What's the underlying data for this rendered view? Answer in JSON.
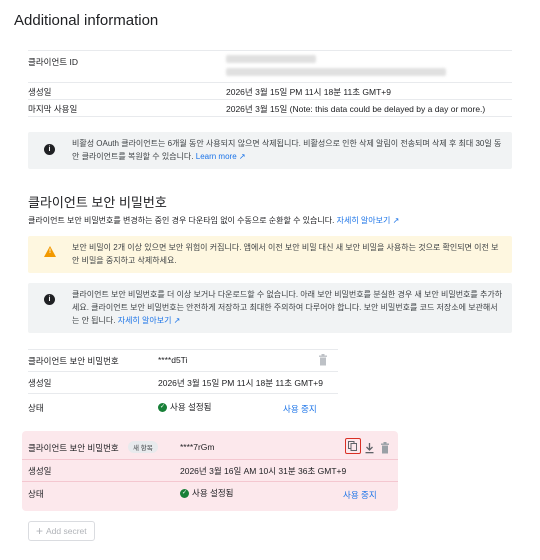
{
  "page_title": "Additional information",
  "client_info": {
    "client_id_label": "클라이언트 ID",
    "created_label": "생성일",
    "created_value": "2026년 3월 15일 PM 11시 18분 11초 GMT+9",
    "last_used_label": "마지막 사용일",
    "last_used_value": "2026년 3월 15일 (Note: this data could be delayed by a day or more.)"
  },
  "inactive_notice": {
    "text": "비활성 OAuth 클라이언트는 6개월 동안 사용되지 않으면 삭제됩니다. 비활성으로 인한 삭제 알림이 전송되며 삭제 후 최대 30일 동안 클라이언트를 복원할 수 있습니다.",
    "link": "Learn more"
  },
  "secrets_section": {
    "title": "클라이언트 보안 비밀번호",
    "description": "클라이언트 보안 비밀번호를 변경하는 중인 경우 다운타임 없이 수동으로 순환할 수 있습니다.",
    "description_link": "자세히 알아보기"
  },
  "warning_notice": {
    "text": "보안 비밀이 2개 이상 있으면 보안 위험이 커집니다. 앱에서 이전 보안 비밀 대신 새 보안 비밀을 사용하는 것으로 확인되면 이전 보안 비밀을 중지하고 삭제하세요."
  },
  "download_notice": {
    "text": "클라이언트 보안 비밀번호를 더 이상 보거나 다운로드할 수 없습니다. 아래 보안 비밀번호를 분실한 경우 새 보안 비밀번호를 추가하세요. 클라이언트 보안 비밀번호는 안전하게 저장하고 최대한 주의하여 다루어야 합니다. 보안 비밀번호를 코드 저장소에 보관해서는 안 됩니다.",
    "link": "자세히 알아보기"
  },
  "secret1": {
    "label": "클라이언트 보안 비밀번호",
    "value": "****d5Ti",
    "created_label": "생성일",
    "created_value": "2026년 3월 15일 PM 11시 18분 11초 GMT+9",
    "status_label": "상태",
    "status_value": "사용 설정됨",
    "action": "사용 중지"
  },
  "secret2": {
    "label": "클라이언트 보안 비밀번호",
    "badge": "새 항목",
    "value": "****7rGm",
    "created_label": "생성일",
    "created_value": "2026년 3월 16일 AM 10시 31분 36초 GMT+9",
    "status_label": "상태",
    "status_value": "사용 설정됨",
    "action": "사용 중지"
  },
  "add_secret_label": "Add secret",
  "icons": {
    "info": "info-icon",
    "warning": "warning-icon",
    "check": "check-circle-icon",
    "trash": "trash-icon",
    "copy": "copy-icon",
    "download": "download-icon",
    "external": "external-link-icon",
    "plus": "plus-icon"
  },
  "colors": {
    "accent": "#1a73e8",
    "success": "#188038",
    "warning": "#f29900",
    "new_secret_bg": "#fce8ec",
    "copy_highlight": "#d93025"
  }
}
